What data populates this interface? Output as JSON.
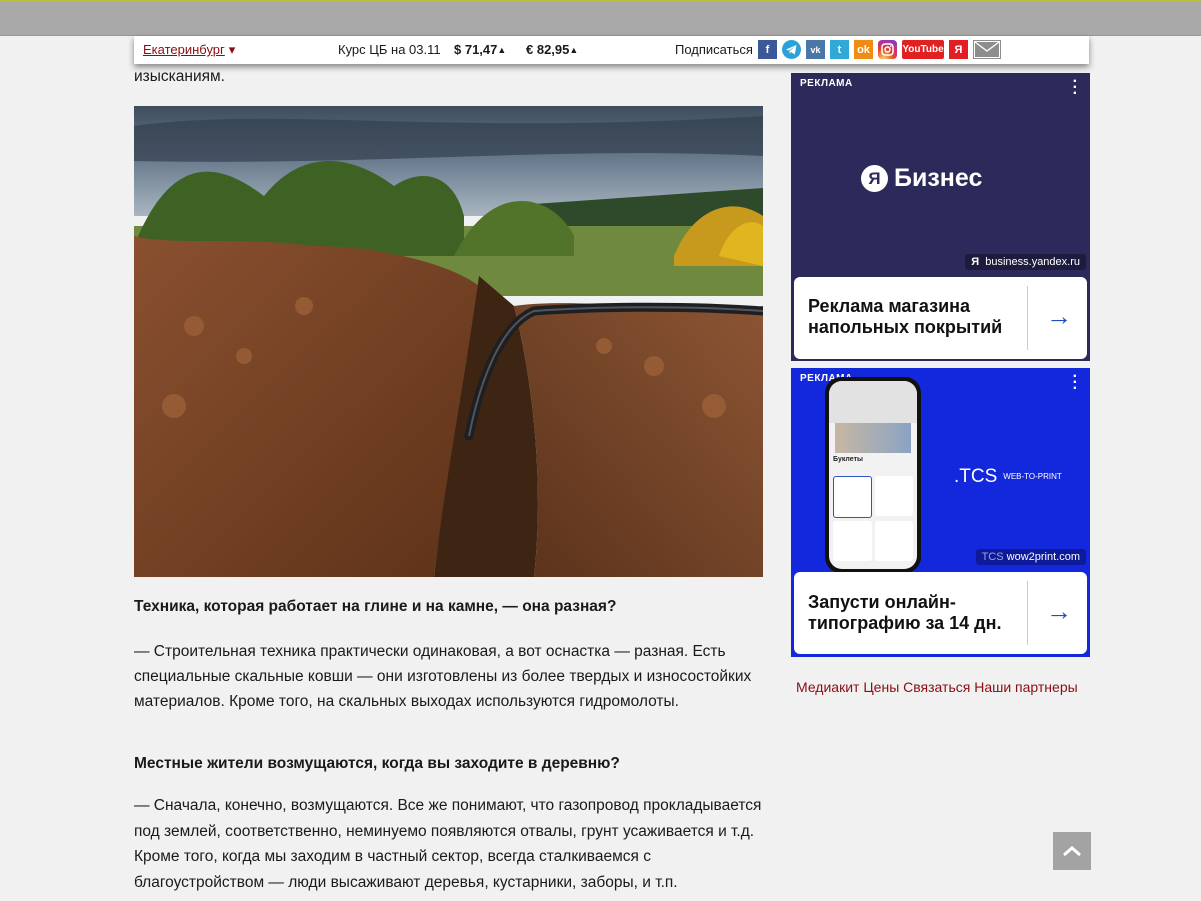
{
  "topbar": {
    "city": "Екатеринбург",
    "city_arrow": "▾",
    "rate_label": "Курс ЦБ на 03.11",
    "usd": "$ 71,47",
    "eur": "€ 82,95",
    "up_arrow": "▲",
    "subscribe": "Подписаться",
    "social": [
      "f",
      "vk",
      "t",
      "ok",
      "YouTube",
      "Я"
    ]
  },
  "article": {
    "lead_fragment": "изысканиям.",
    "question1": "Техника, которая работает на глине и на камне, — она разная?",
    "answer1": "— Строительная техника практически одинаковая, а вот оснастка — разная. Есть специальные скальные ковши — они изготовлены из более твердых и износостойких материалов. Кроме того, на скальных выходах используются гидромолоты.",
    "question2": "Местные жители возмущаются, когда вы заходите в деревню?",
    "answer2": "— Сначала, конечно, возмущаются. Все же понимают, что газопровод прокладывается под землей, соответственно, неминуемо появляются отвалы, грунт усаживается и т.д. Кроме того, когда мы заходим в частный сектор, всегда сталкиваемся с благоустройством — люди высаживают деревья, кустарники, заборы, и т.п."
  },
  "ads": [
    {
      "label": "РЕКЛАМА",
      "brand_letter": "Я",
      "brand": "Бизнес",
      "domain_letter": "Я",
      "domain": "business.yandex.ru",
      "cta": "Реклама магазина напольных покрытий",
      "arrow": "→"
    },
    {
      "label": "РЕКЛАМА",
      "brand": ".TCS",
      "tagline": "WEB-TO-PRINT",
      "phone_heading": "Буклеты",
      "domain_prefix": "TCS",
      "domain": "wow2print.com",
      "cta": "Запусти онлайн-типографию за 14 дн.",
      "arrow": "→"
    }
  ],
  "footer_links": [
    "Медиакит",
    "Цены",
    "Связаться",
    "Наши партнеры"
  ],
  "colors": {
    "accent": "#8b0d12",
    "ad1_bg": "#2b2a5a",
    "ad2_bg": "#1327dd"
  }
}
